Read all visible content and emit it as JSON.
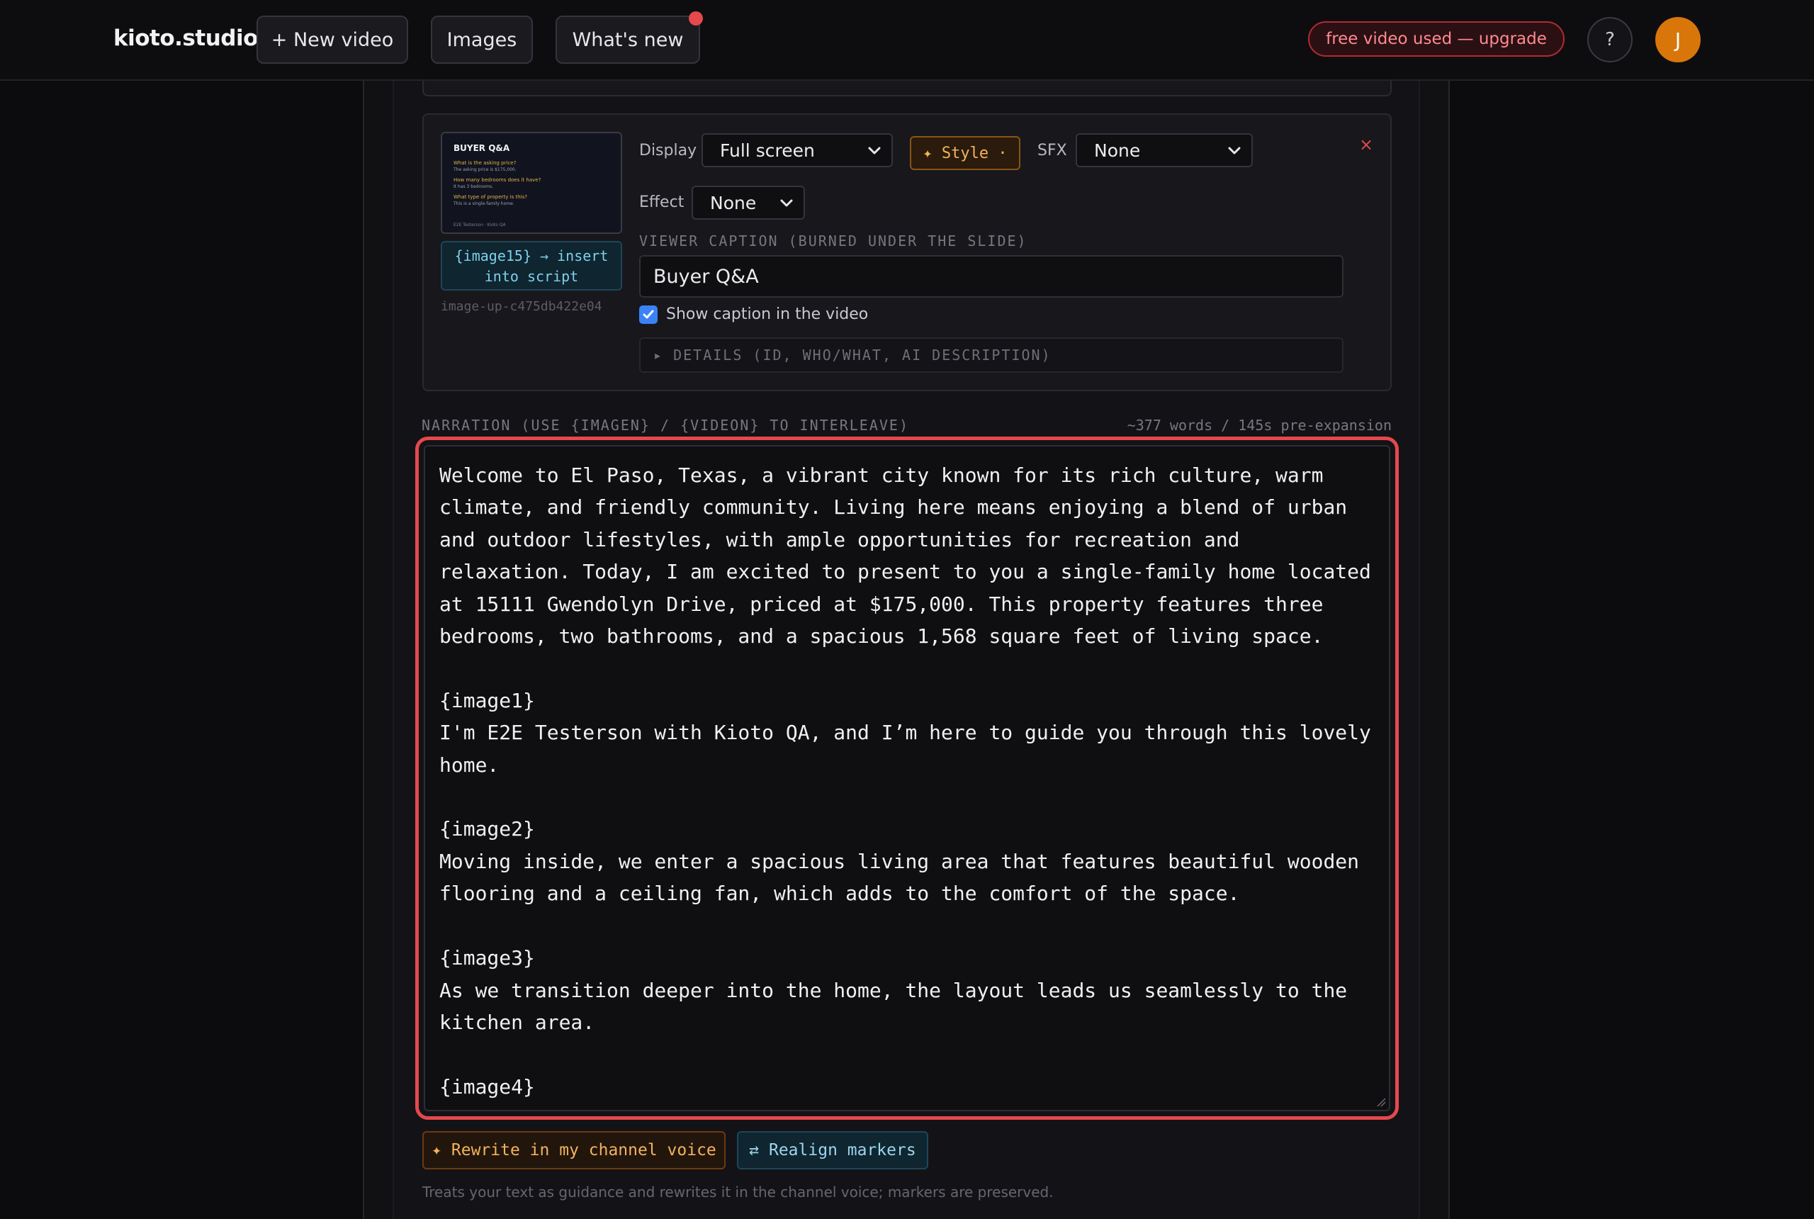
{
  "header": {
    "logo": "kioto.studio",
    "nav": {
      "new_video": "+ New video",
      "images": "Images",
      "whats_new": "What's new"
    },
    "upgrade": "free video used — upgrade",
    "help": "?",
    "avatar_initial": "J"
  },
  "slide": {
    "thumbnail": {
      "title": "BUYER Q&A",
      "lines": [
        {
          "q": "What is the asking price?",
          "a": "The asking price is $175,000."
        },
        {
          "q": "How many bedrooms does it have?",
          "a": "It has 3 bedrooms."
        },
        {
          "q": "What type of property is this?",
          "a": "This is a single-family home."
        }
      ],
      "footer": "E2E Testerson · Kioto QA"
    },
    "insert_chip": "{image15} → insert into script",
    "image_id": "image-up-c475db422e04",
    "display_label": "Display",
    "display_value": "Full screen",
    "style_button": "✦ Style ·",
    "sfx_label": "SFX",
    "sfx_value": "None",
    "effect_label": "Effect",
    "effect_value": "None",
    "caption_label": "VIEWER CAPTION (BURNED UNDER THE SLIDE)",
    "caption_value": "Buyer Q&A",
    "show_caption_label": "Show caption in the video",
    "show_caption_checked": true,
    "details_label": "▸ DETAILS (ID, WHO/WHAT, AI DESCRIPTION)",
    "close": "×"
  },
  "narration": {
    "label": "NARRATION (USE {IMAGEN} / {VIDEON} TO INTERLEAVE)",
    "word_count": "~377 words / 145s pre-expansion",
    "text": "Welcome to El Paso, Texas, a vibrant city known for its rich culture, warm climate, and friendly community. Living here means enjoying a blend of urban and outdoor lifestyles, with ample opportunities for recreation and relaxation. Today, I am excited to present to you a single-family home located at 15111 Gwendolyn Drive, priced at $175,000. This property features three bedrooms, two bathrooms, and a spacious 1,568 square feet of living space.\n\n{image1}\nI'm E2E Testerson with Kioto QA, and I’m here to guide you through this lovely home.\n\n{image2}\nMoving inside, we enter a spacious living area that features beautiful wooden flooring and a ceiling fan, which adds to the comfort of the space.\n\n{image3}\nAs we transition deeper into the home, the layout leads us seamlessly to the kitchen area.\n\n{image4}",
    "rewrite_button": "✦ Rewrite in my channel voice",
    "realign_button": "⇄ Realign markers",
    "hint": "Treats your text as guidance and rewrites it in the channel voice; markers are preserved."
  },
  "colors": {
    "accent_red": "#e5484d",
    "avatar_orange": "#d9760a",
    "style_amber": "#f2b25e",
    "insert_cyan": "#7fd0ea",
    "checkbox_blue": "#3b82f6"
  }
}
